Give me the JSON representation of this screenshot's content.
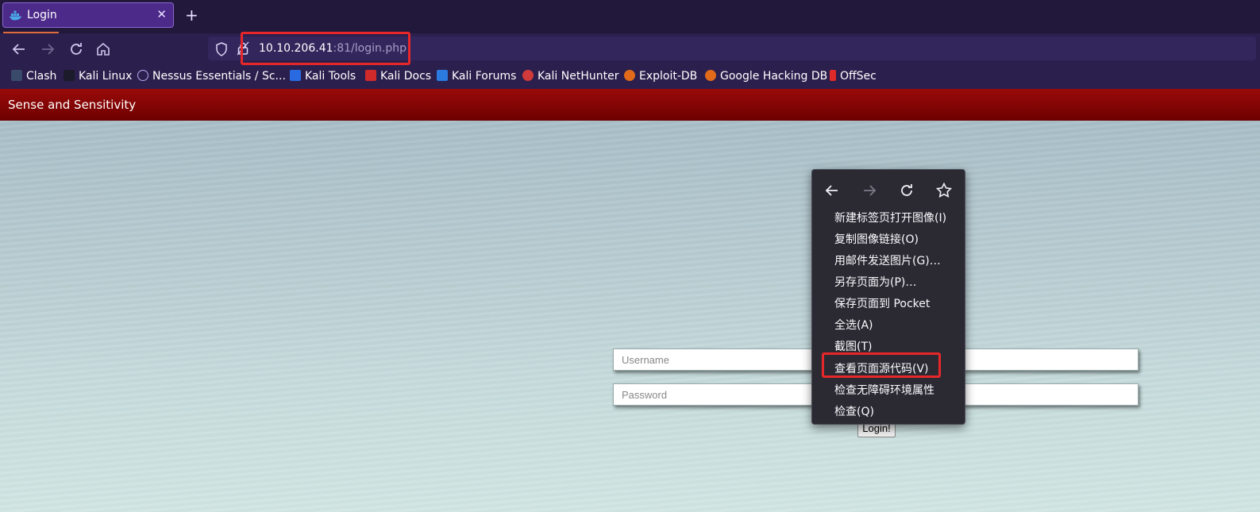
{
  "tab": {
    "title": "Login",
    "close": "✕",
    "new_tab": "+"
  },
  "navbar": {
    "url_host": "10.10.206.41",
    "url_rest": ":81/login.php"
  },
  "bookmarks": [
    {
      "label": "Clash",
      "color": "#3a4a6a"
    },
    {
      "label": "Kali Linux",
      "color": "#1b1b2b"
    },
    {
      "label": "Nessus Essentials / Sc...",
      "color": "#6a5ad0"
    },
    {
      "label": "Kali Tools",
      "color": "#2a6ae0"
    },
    {
      "label": "Kali Docs",
      "color": "#d02a2a"
    },
    {
      "label": "Kali Forums",
      "color": "#2a7ae0"
    },
    {
      "label": "Kali NetHunter",
      "color": "#d03a3a"
    },
    {
      "label": "Exploit-DB",
      "color": "#e06a1a"
    },
    {
      "label": "Google Hacking DB",
      "color": "#e06a1a"
    },
    {
      "label": "OffSec",
      "color": "#e02a2a"
    }
  ],
  "page": {
    "site_title": "Sense and Sensitivity",
    "username_placeholder": "Username",
    "password_placeholder": "Password",
    "login_label": "Login!"
  },
  "context_menu": {
    "items": [
      "新建标签页打开图像(I)",
      "复制图像链接(O)",
      "用邮件发送图片(G)…",
      "另存页面为(P)…",
      "保存页面到 Pocket",
      "全选(A)",
      "截图(T)",
      "查看页面源代码(V)",
      "检查无障碍环境属性",
      "检查(Q)"
    ]
  },
  "colors": {
    "annotation": "#e8272a",
    "header_red": "#8b0000",
    "tab_active": "#4c2a8a"
  }
}
